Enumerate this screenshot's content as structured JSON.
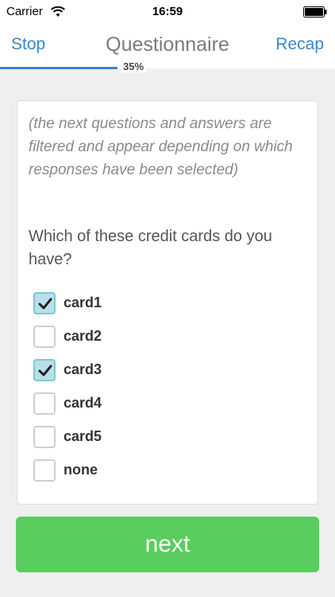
{
  "status_bar": {
    "carrier": "Carrier",
    "time": "16:59"
  },
  "nav": {
    "left": "Stop",
    "title": "Questionnaire",
    "right": "Recap"
  },
  "progress": {
    "label": "35%",
    "value": 0.35,
    "color": "#3b86c6"
  },
  "card": {
    "intro": "(the next questions and answers are filtered and appear depending on which responses have been selected)",
    "question": "Which of these credit cards do you have?",
    "options": [
      {
        "label": "card1",
        "checked": true
      },
      {
        "label": "card2",
        "checked": false
      },
      {
        "label": "card3",
        "checked": true
      },
      {
        "label": "card4",
        "checked": false
      },
      {
        "label": "card5",
        "checked": false
      },
      {
        "label": "none",
        "checked": false
      }
    ]
  },
  "next_button": {
    "label": "next",
    "color": "#59cd5d"
  },
  "icons": {
    "wifi": "wifi-icon",
    "battery": "battery-icon",
    "check": "checkmark-icon"
  }
}
